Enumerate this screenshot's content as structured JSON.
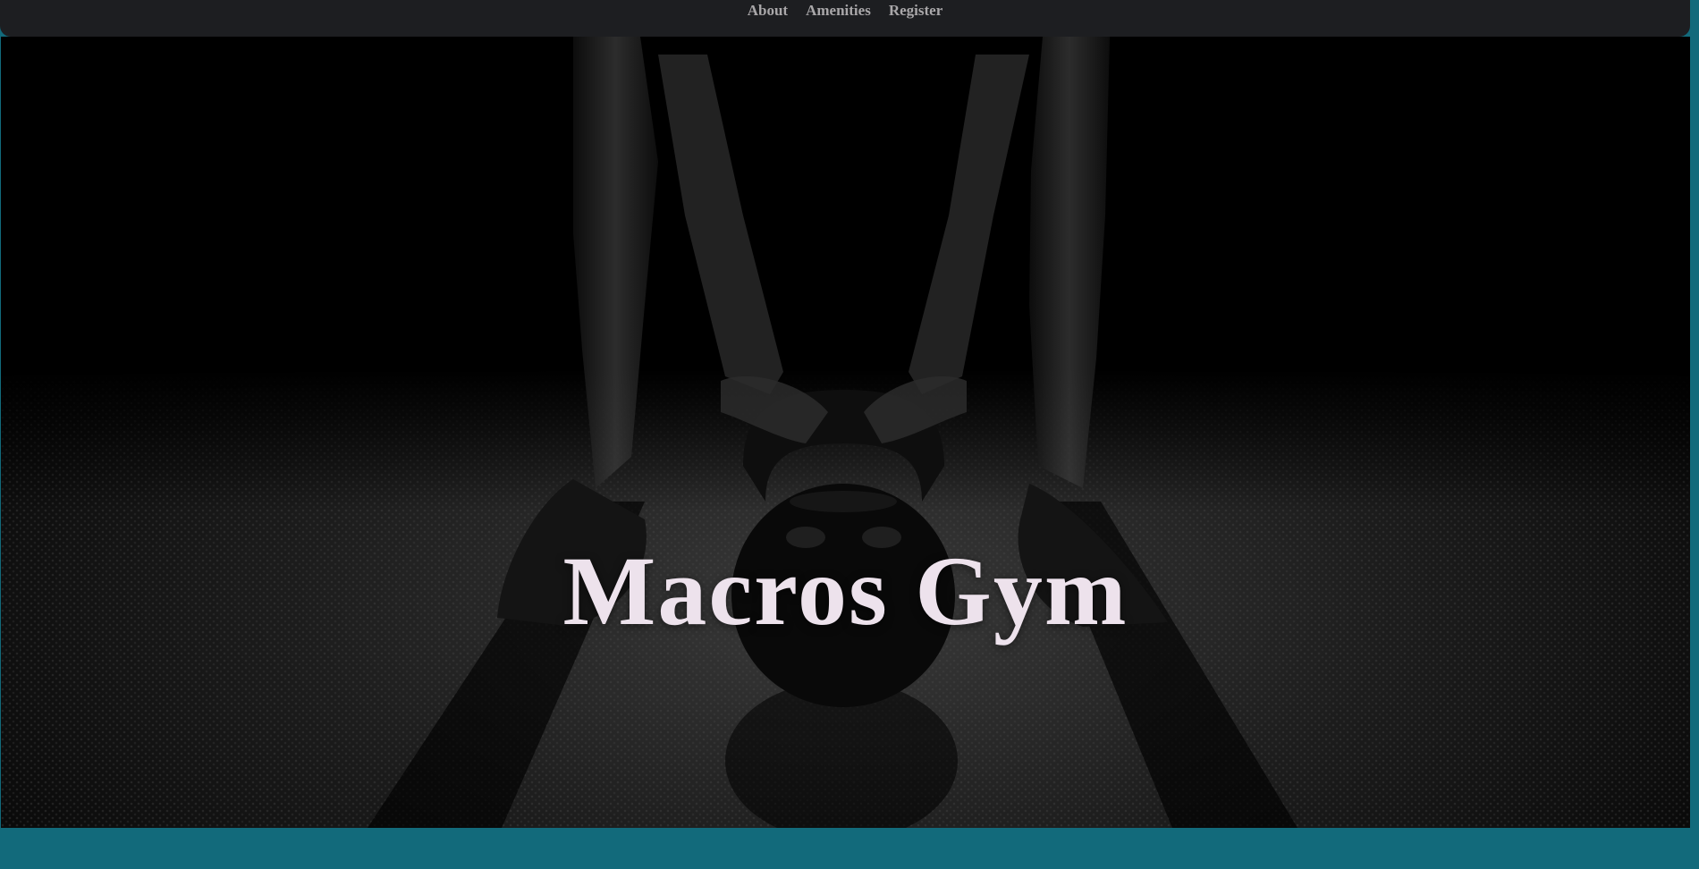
{
  "nav": {
    "items": [
      {
        "label": "About"
      },
      {
        "label": "Amenities"
      },
      {
        "label": "Register"
      }
    ]
  },
  "hero": {
    "title": "Macros Gym",
    "image": "kettlebell-athlete-photo"
  },
  "colors": {
    "nav_bg": "#1d1e21",
    "nav_text": "#a9a7a9",
    "title_text": "#ede2ec",
    "page_accent": "#126a7b"
  }
}
